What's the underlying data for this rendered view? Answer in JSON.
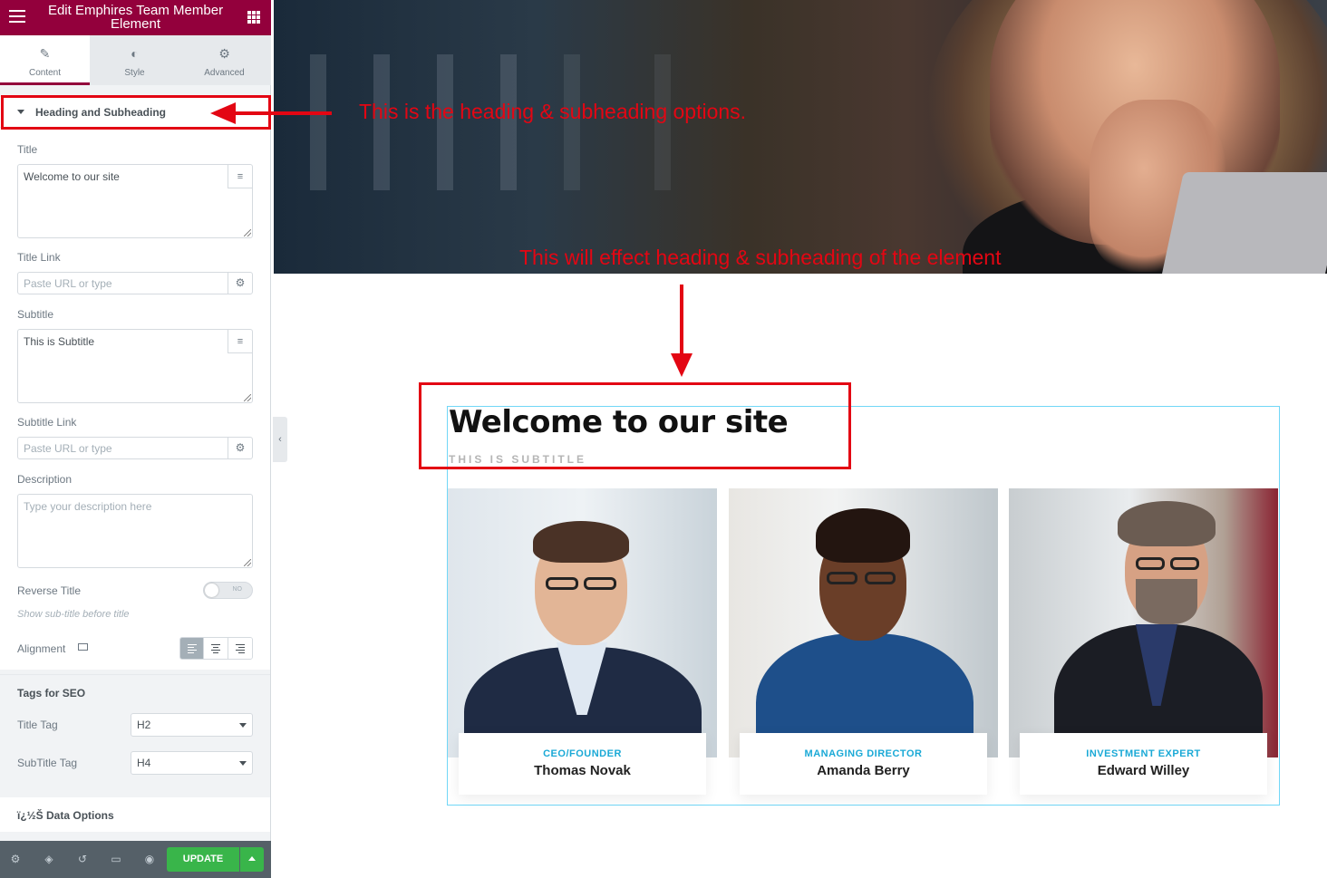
{
  "panel": {
    "header_title": "Edit Emphires Team Member Element",
    "tabs": [
      {
        "label": "Content",
        "icon": "pencil-icon",
        "active": true
      },
      {
        "label": "Style",
        "icon": "half-circle-icon",
        "active": false
      },
      {
        "label": "Advanced",
        "icon": "gear-icon",
        "active": false
      }
    ],
    "section_title": "Heading and Subheading",
    "fields": {
      "title_label": "Title",
      "title_value": "Welcome to our site",
      "title_link_label": "Title Link",
      "title_link_placeholder": "Paste URL or type",
      "subtitle_label": "Subtitle",
      "subtitle_value": "This is Subtitle",
      "subtitle_link_label": "Subtitle Link",
      "subtitle_link_placeholder": "Paste URL or type",
      "description_label": "Description",
      "description_placeholder": "Type your description here",
      "reverse_title_label": "Reverse Title",
      "reverse_title_toggle": "NO",
      "reverse_title_hint": "Show sub-title before title",
      "alignment_label": "Alignment",
      "alignment_selected": "left"
    },
    "seo": {
      "heading": "Tags for SEO",
      "title_tag_label": "Title Tag",
      "title_tag_value": "H2",
      "subtitle_tag_label": "SubTitle Tag",
      "subtitle_tag_value": "H4"
    },
    "data_options_label": "ï¿½Š Data Options",
    "footer": {
      "update_label": "UPDATE",
      "icons": [
        "settings-icon",
        "layers-icon",
        "history-icon",
        "responsive-icon",
        "preview-icon"
      ]
    }
  },
  "annotations": {
    "panel_note": "This is the heading & subheading options.",
    "canvas_note": "This will effect heading & subheading of the element"
  },
  "widget": {
    "title": "Welcome to our site",
    "subtitle": "THIS IS SUBTITLE",
    "members": [
      {
        "role": "CEO/FOUNDER",
        "name": "Thomas Novak"
      },
      {
        "role": "MANAGING DIRECTOR",
        "name": "Amanda Berry"
      },
      {
        "role": "INVESTMENT EXPERT",
        "name": "Edward Willey"
      }
    ]
  },
  "colors": {
    "brand": "#93003c",
    "annotation_red": "#e30613",
    "accent_blue": "#1aa9d6",
    "update_green": "#39b54a"
  }
}
